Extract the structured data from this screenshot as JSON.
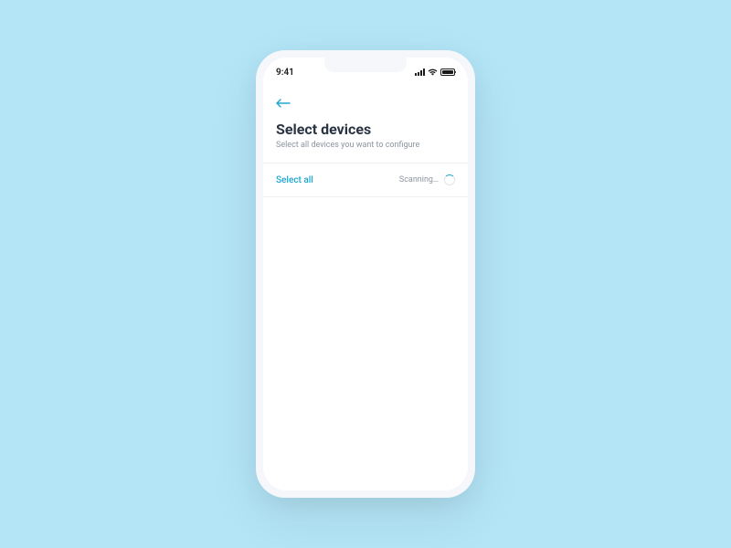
{
  "statusBar": {
    "time": "9:41"
  },
  "header": {
    "title": "Select devices",
    "subtitle": "Select all devices you want to configure"
  },
  "actions": {
    "selectAllLabel": "Select all",
    "scanningLabel": "Scanning…"
  }
}
